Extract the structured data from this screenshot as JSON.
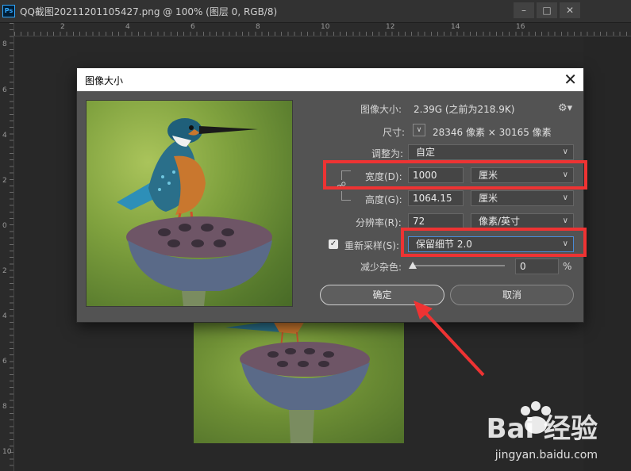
{
  "window": {
    "title": "QQ截图20211201105427.png @ 100% (图层 0, RGB/8)",
    "logo": "Ps",
    "minimize_icon": "minimize-icon",
    "maximize_icon": "maximize-icon",
    "close_icon": "close-icon"
  },
  "rulers": {
    "horizontal_ticks": [
      "2",
      "4",
      "6",
      "8",
      "10",
      "12",
      "14",
      "16"
    ],
    "vertical_ticks": [
      "8",
      "6",
      "4",
      "2",
      "0",
      "2",
      "4",
      "6",
      "8",
      "10"
    ]
  },
  "dialog": {
    "title": "图像大小",
    "image_size_label": "图像大小:",
    "image_size_value": "2.39G (之前为218.9K)",
    "dimensions_label": "尺寸:",
    "dimensions_value": "28346 像素  ×  30165 像素",
    "fit_to_label": "调整为:",
    "fit_to_value": "自定",
    "width_label": "宽度(D):",
    "width_value": "1000",
    "width_unit": "厘米",
    "height_label": "高度(G):",
    "height_value": "1064.15",
    "height_unit": "厘米",
    "resolution_label": "分辨率(R):",
    "resolution_value": "72",
    "resolution_unit": "像素/英寸",
    "resample_label": "重新采样(S):",
    "resample_checked": true,
    "resample_value": "保留细节 2.0",
    "noise_label": "减少杂色:",
    "noise_value": "0",
    "noise_unit": "%",
    "noise_level": 0,
    "ok_label": "确定",
    "cancel_label": "取消"
  },
  "watermark": {
    "brand": "Bai 经验",
    "url": "jingyan.baidu.com"
  },
  "colors": {
    "annotation_red": "#ee3333",
    "dialog_bg": "#535353",
    "workspace_bg": "#282828"
  }
}
